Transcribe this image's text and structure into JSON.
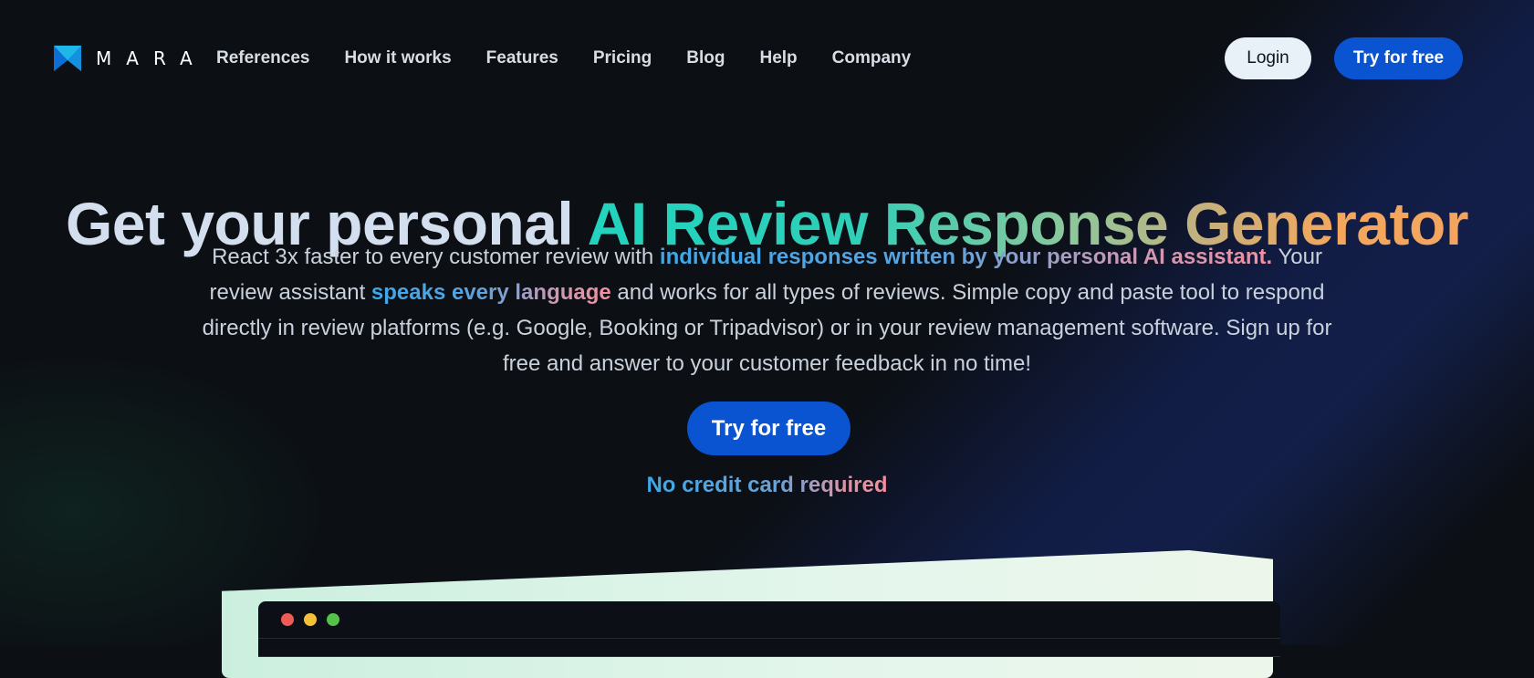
{
  "brand": {
    "name": "MARA",
    "logo_colors": [
      "#1fb6e8",
      "#0a6fd6"
    ]
  },
  "nav": {
    "links": [
      "References",
      "How it works",
      "Features",
      "Pricing",
      "Blog",
      "Help",
      "Company"
    ],
    "login_label": "Login",
    "try_label": "Try for free"
  },
  "hero": {
    "title_plain": "Get your personal ",
    "title_gradient": "AI Review Response Generator",
    "sub_1": "React 3x faster to every customer review with ",
    "sub_hl_1": "individual responses written by your personal AI assistant.",
    "sub_2": " Your review assistant ",
    "sub_hl_2": "speaks every language",
    "sub_3": " and works for all types of reviews. Simple copy and paste tool to respond directly in review platforms (e.g. Google, Booking or Tripadvisor) or in your review management software. Sign up for free and answer to your customer feedback in no time!",
    "cta_label": "Try for free",
    "no_credit_card": "No credit card required"
  },
  "preview_window": {
    "dot_colors": [
      "#ee5a55",
      "#f5c037",
      "#53c249"
    ]
  }
}
